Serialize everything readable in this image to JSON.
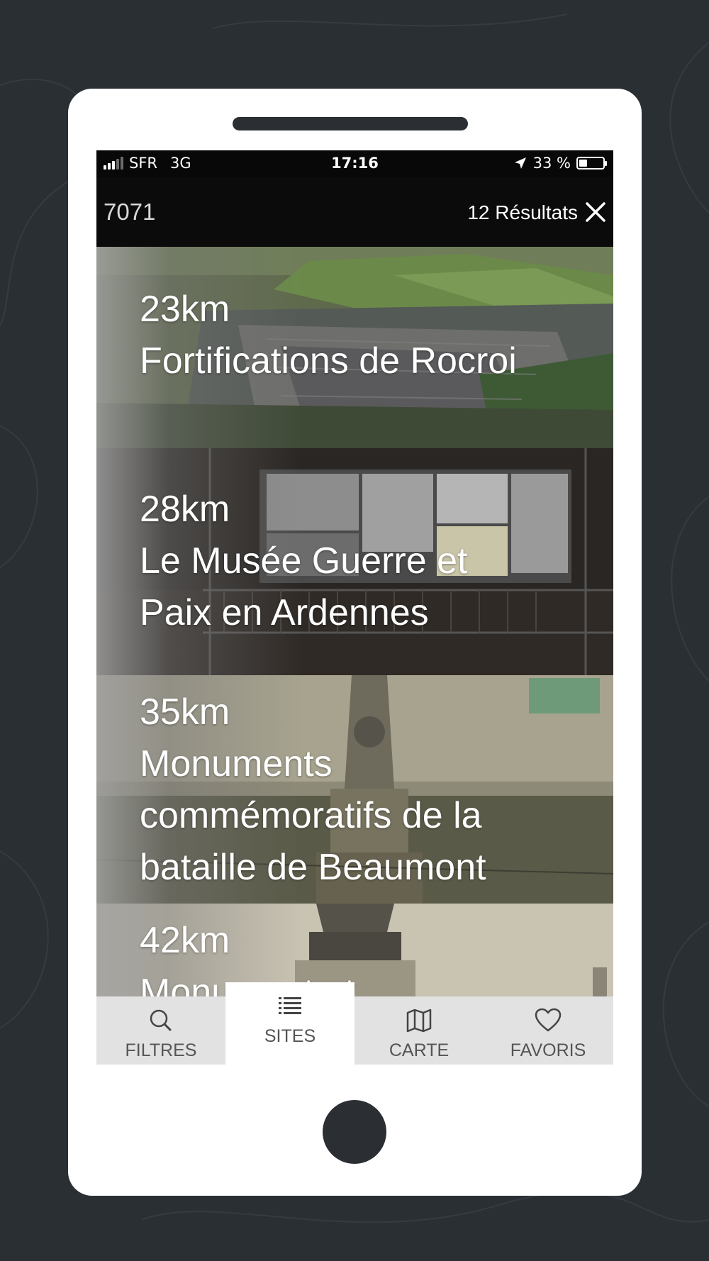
{
  "status_bar": {
    "carrier": "SFR",
    "network": "3G",
    "time": "17:16",
    "battery_text": "33 %",
    "battery_level": 0.33
  },
  "header": {
    "search_code": "7071",
    "results_label": "12 Résultats"
  },
  "sites": [
    {
      "distance": "23km",
      "title_lines": [
        "Fortifications de Rocroi"
      ]
    },
    {
      "distance": "28km",
      "title_lines": [
        "Le Musée Guerre et",
        "Paix en Ardennes"
      ]
    },
    {
      "distance": "35km",
      "title_lines": [
        "Monuments",
        "commémoratifs de la",
        "bataille de Beaumont"
      ]
    },
    {
      "distance": "42km",
      "title_lines": [
        "Monument et"
      ]
    }
  ],
  "tabs": [
    {
      "label": "FILTRES",
      "icon": "search-icon",
      "active": false
    },
    {
      "label": "SITES",
      "icon": "list-icon",
      "active": true
    },
    {
      "label": "CARTE",
      "icon": "map-icon",
      "active": false
    },
    {
      "label": "FAVORIS",
      "icon": "heart-icon",
      "active": false
    }
  ],
  "colors": {
    "page_background": "#2a2f34",
    "phone_body": "#ffffff",
    "tabbar_background": "#e2e2e2",
    "active_tab_background": "#ffffff"
  }
}
